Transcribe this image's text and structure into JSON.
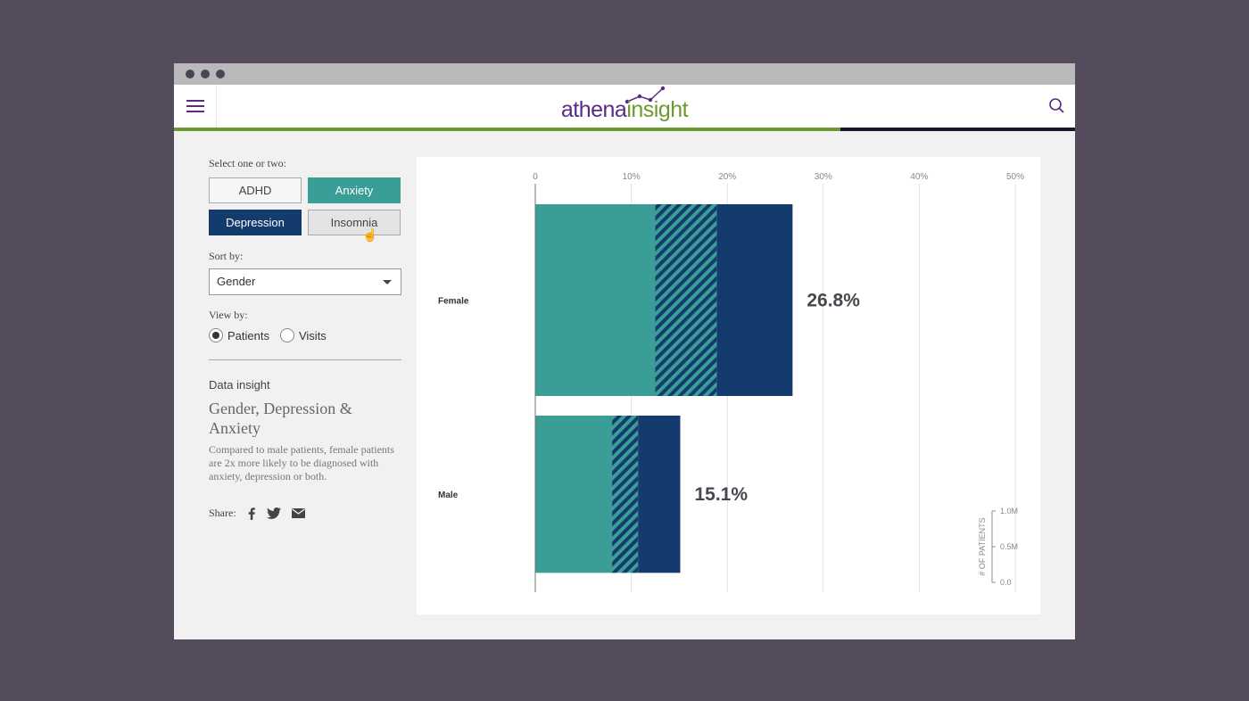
{
  "colors": {
    "teal": "#3a9d96",
    "navy": "#133b6e",
    "brand_purple": "#5b2a86",
    "brand_green": "#6d9a2e"
  },
  "brand": {
    "part1": "athena",
    "part2": "insight"
  },
  "icons": {
    "menu": "hamburger-menu-icon",
    "search": "search-icon",
    "facebook": "facebook-icon",
    "twitter": "twitter-icon",
    "email": "email-icon",
    "cursor": "hand-pointer-icon"
  },
  "page_progress": 0.74,
  "controls": {
    "select_label": "Select one or two:",
    "conditions": [
      {
        "label": "ADHD",
        "selected": false
      },
      {
        "label": "Anxiety",
        "selected": true,
        "color": "#3a9d96"
      },
      {
        "label": "Depression",
        "selected": true,
        "color": "#133b6e"
      },
      {
        "label": "Insomnia",
        "selected": false
      }
    ],
    "sort_label": "Sort by:",
    "sort_value": "Gender",
    "view_label": "View by:",
    "view_options": [
      {
        "label": "Patients",
        "selected": true
      },
      {
        "label": "Visits",
        "selected": false
      }
    ]
  },
  "insight": {
    "label": "Data insight",
    "title": "Gender, Depression & Anxiety",
    "text": "Compared to male patients, female patients are 2x more likely to be diagnosed with anxiety, depression or both."
  },
  "share": {
    "label": "Share:"
  },
  "chart_data": {
    "type": "bar",
    "orientation": "horizontal",
    "stacked": true,
    "x_ticks": [
      "0",
      "10%",
      "20%",
      "30%",
      "40%",
      "50%"
    ],
    "xlim": [
      0,
      50
    ],
    "grid": true,
    "categories": [
      "Female",
      "Male"
    ],
    "series": [
      {
        "values": [
          12.5,
          8.0
        ],
        "color": "#3a9d96",
        "pattern": "solid"
      },
      {
        "values": [
          6.4,
          2.7
        ],
        "color": "#3a9d96",
        "pattern": "hatched"
      },
      {
        "values": [
          7.9,
          4.4
        ],
        "color": "#133b6e",
        "pattern": "solid"
      }
    ],
    "totals": [
      "26.8%",
      "15.1%"
    ],
    "bar_height_legend": {
      "title": "# OF PATIENTS",
      "ticks": [
        "1.0M",
        "0.5M",
        "0.0"
      ],
      "range": [
        0,
        1.0
      ]
    },
    "bar_patients_millions": [
      1.0,
      0.82
    ]
  }
}
